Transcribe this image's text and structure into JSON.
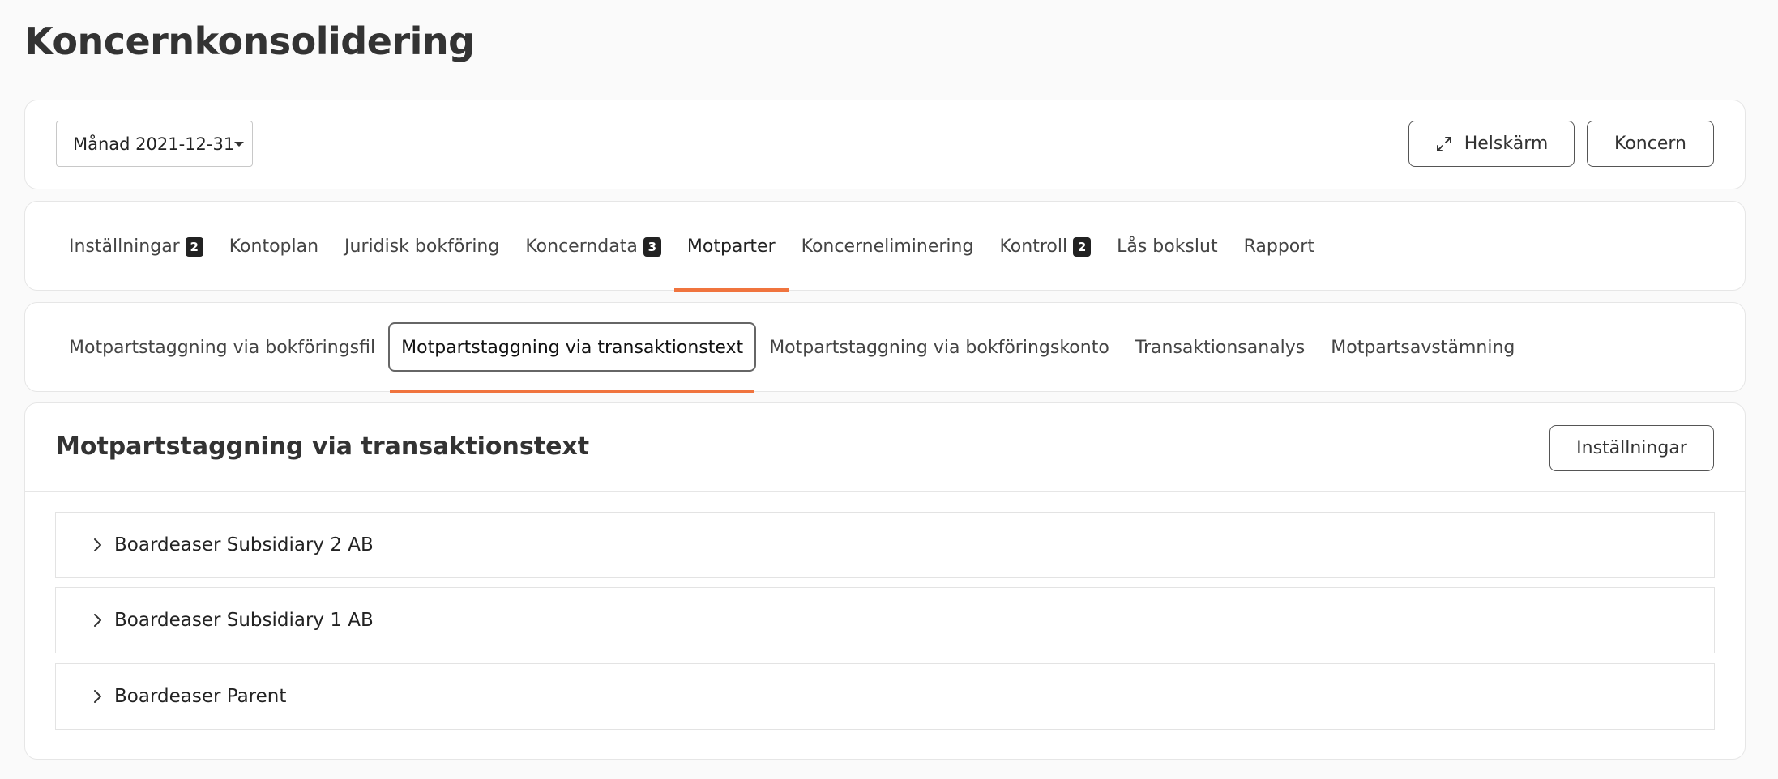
{
  "page": {
    "title": "Koncernkonsolidering"
  },
  "toolbar": {
    "period_label": "Månad 2021-12-31",
    "fullscreen_label": "Helskärm",
    "koncern_label": "Koncern"
  },
  "tabs": [
    {
      "label": "Inställningar",
      "badge": "2"
    },
    {
      "label": "Kontoplan",
      "badge": ""
    },
    {
      "label": "Juridisk bokföring",
      "badge": ""
    },
    {
      "label": "Koncerndata",
      "badge": "3"
    },
    {
      "label": "Motparter",
      "badge": ""
    },
    {
      "label": "Koncerneliminering",
      "badge": ""
    },
    {
      "label": "Kontroll",
      "badge": "2"
    },
    {
      "label": "Lås bokslut",
      "badge": ""
    },
    {
      "label": "Rapport",
      "badge": ""
    }
  ],
  "active_tab": "Motparter",
  "subtabs": [
    {
      "label": "Motpartstaggning via bokföringsfil"
    },
    {
      "label": "Motpartstaggning via transaktionstext"
    },
    {
      "label": "Motpartstaggning via bokföringskonto"
    },
    {
      "label": "Transaktionsanalys"
    },
    {
      "label": "Motpartsavstämning"
    }
  ],
  "active_subtab": "Motpartstaggning via transaktionstext",
  "content": {
    "title": "Motpartstaggning via transaktionstext",
    "settings_label": "Inställningar",
    "items": [
      {
        "label": "Boardeaser Subsidiary 2 AB"
      },
      {
        "label": "Boardeaser Subsidiary 1 AB"
      },
      {
        "label": "Boardeaser Parent"
      }
    ]
  },
  "colors": {
    "accent": "#f0743e",
    "badge_bg": "#222222",
    "text": "#333333"
  }
}
